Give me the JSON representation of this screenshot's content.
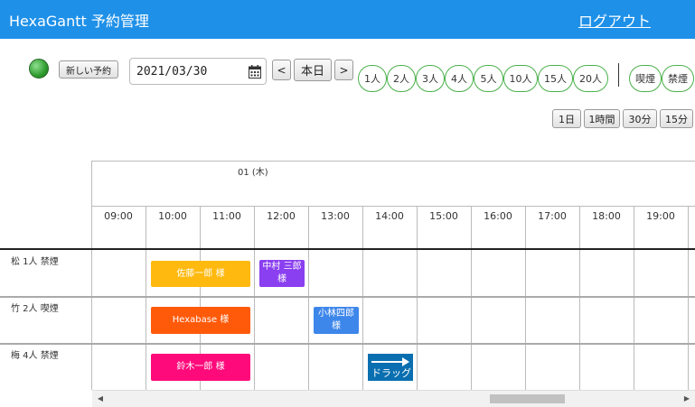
{
  "header": {
    "title": "HexaGantt 予約管理",
    "logout": "ログアウト"
  },
  "toolbar": {
    "new_booking": "新しい予約",
    "date_value": "2021/03/30",
    "prev": "<",
    "today": "本日",
    "next": ">",
    "party_sizes": [
      "1人",
      "2人",
      "3人",
      "4人",
      "5人",
      "10人",
      "15人",
      "20人"
    ],
    "smoking_filters": [
      "喫煙",
      "禁煙"
    ],
    "zoom_options": [
      "1日",
      "1時間",
      "30分",
      "15分"
    ]
  },
  "grid": {
    "day_label": "01 (木)",
    "hours": [
      "09:00",
      "10:00",
      "11:00",
      "12:00",
      "13:00",
      "14:00",
      "15:00",
      "16:00",
      "17:00",
      "18:00",
      "19:00"
    ],
    "rows": [
      "松 1人 禁煙",
      "竹 2人 喫煙",
      "梅 4人 禁煙"
    ]
  },
  "bookings": [
    {
      "name": "佐藤一郎 様",
      "color": "#ffb90f"
    },
    {
      "name": "中村 三郎 様",
      "color": "#8a3ff0"
    },
    {
      "name": "Hexabase 様",
      "color": "#ff5a0a"
    },
    {
      "name": "小林四郎 様",
      "color": "#3d86ea"
    },
    {
      "name": "鈴木一郎 様",
      "color": "#ff0a7b"
    }
  ],
  "drag": {
    "label": "ドラッグ",
    "color": "#0a6fb0"
  },
  "colors": {
    "header": "#1e90e8",
    "status": "#2e9b2e",
    "pill_border": "#4ab04a"
  }
}
